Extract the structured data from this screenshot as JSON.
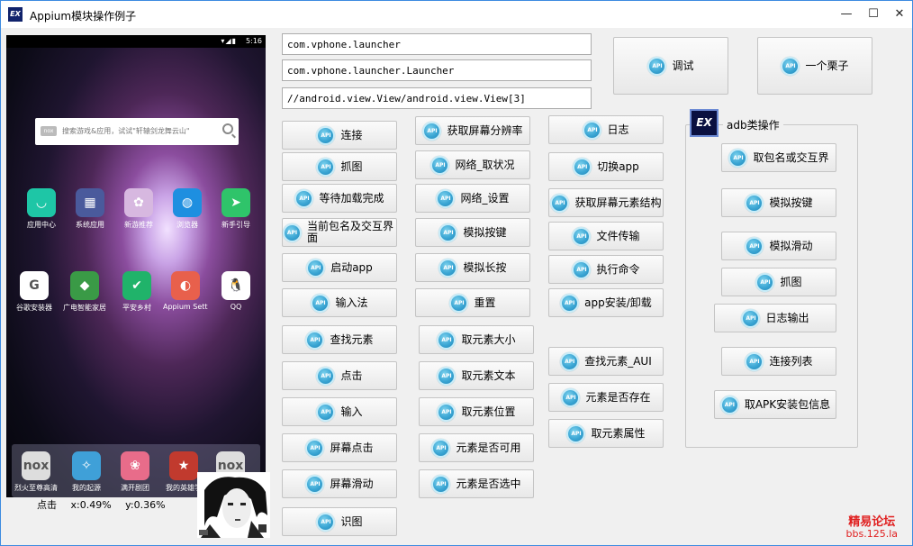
{
  "window": {
    "logo": "EX",
    "title": "Appium模块操作例子",
    "minimize": "—",
    "maximize": "☐",
    "close": "✕"
  },
  "phone": {
    "status_icons": "▾◢▮",
    "time": "5:16",
    "search_logo": "nox",
    "search_placeholder": "搜索游戏&应用，试试\"轩辕剑龙舞云山\"",
    "apps_row1": [
      {
        "label": "应用中心",
        "color": "#1ec6a6",
        "glyph": "◡"
      },
      {
        "label": "系统应用",
        "color": "#4a5a9c",
        "glyph": "▦"
      },
      {
        "label": "新游推荐",
        "color": "#d7b8e0",
        "glyph": "✿"
      },
      {
        "label": "浏览器",
        "color": "#1e8fe0",
        "glyph": "◍"
      },
      {
        "label": "新手引导",
        "color": "#2fc46a",
        "glyph": "➤"
      }
    ],
    "apps_row2": [
      {
        "label": "谷歌安装器",
        "color": "#ffffff",
        "glyph": "G"
      },
      {
        "label": "广电智能家居",
        "color": "#3a9a46",
        "glyph": "◆"
      },
      {
        "label": "平安乡村",
        "color": "#20b36a",
        "glyph": "✔"
      },
      {
        "label": "Appium Setti",
        "color": "#e8604c",
        "glyph": "◐"
      },
      {
        "label": "QQ",
        "color": "#ffffff",
        "glyph": "🐧"
      }
    ],
    "dock": [
      {
        "label": "烈火至尊高清",
        "color": "#dddddd",
        "glyph": "nox"
      },
      {
        "label": "我的起源",
        "color": "#3fa0d8",
        "glyph": "✧"
      },
      {
        "label": "满开剧团",
        "color": "#e86c8a",
        "glyph": "❀"
      },
      {
        "label": "我的英雄学",
        "color": "#c13a2e",
        "glyph": "★"
      },
      {
        "label": "",
        "color": "#dddddd",
        "glyph": "nox"
      }
    ]
  },
  "click_info": {
    "label": "点击",
    "x": "x:0.49%",
    "y": "y:0.36%"
  },
  "fields": {
    "package": "com.vphone.launcher",
    "activity": "com.vphone.launcher.Launcher",
    "xpath": "//android.view.View/android.view.View[3]"
  },
  "api_badge": "API",
  "buttons": {
    "debug": "调试",
    "example": "一个栗子",
    "col1": [
      "连接",
      "抓图",
      "等待加载完成",
      "当前包名及交互界面",
      "启动app",
      "输入法",
      "查找元素",
      "点击",
      "输入",
      "屏幕点击",
      "屏幕滑动",
      "识图"
    ],
    "col2": [
      "获取屏幕分辨率",
      "网络_取状况",
      "网络_设置",
      "模拟按键",
      "模拟长按",
      "重置",
      "取元素大小",
      "取元素文本",
      "取元素位置",
      "元素是否可用",
      "元素是否选中"
    ],
    "col3": [
      "日志",
      "切换app",
      "获取屏幕元素结构",
      "文件传输",
      "执行命令",
      "app安装/卸载",
      "查找元素_AUI",
      "元素是否存在",
      "取元素属性"
    ]
  },
  "adb_group": {
    "icon": "EX",
    "title": "adb类操作",
    "buttons": [
      "取包名或交互界",
      "模拟按键",
      "模拟滑动",
      "抓图",
      "日志输出",
      "连接列表",
      "取APK安装包信息"
    ]
  },
  "watermark": {
    "line1": "精易论坛",
    "line2": "bbs.125.la"
  }
}
